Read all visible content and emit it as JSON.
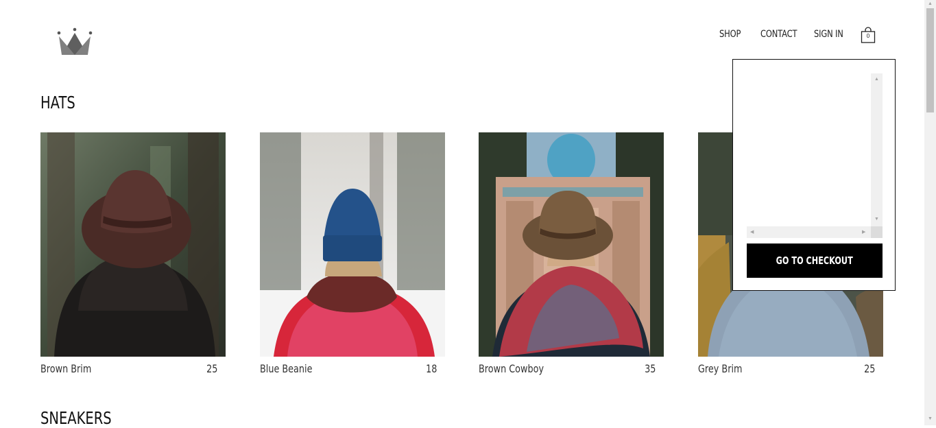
{
  "header": {
    "logo_icon": "crown-icon",
    "nav": [
      {
        "label": "SHOP"
      },
      {
        "label": "CONTACT"
      },
      {
        "label": "SIGN IN"
      }
    ],
    "cart_icon": "shopping-bag-icon",
    "cart_count": "0"
  },
  "sections": [
    {
      "title": "HATS",
      "items": [
        {
          "name": "Brown Brim",
          "price": "25"
        },
        {
          "name": "Blue Beanie",
          "price": "18"
        },
        {
          "name": "Brown Cowboy",
          "price": "35"
        },
        {
          "name": "Grey Brim",
          "price": "25"
        }
      ]
    },
    {
      "title": "SNEAKERS"
    }
  ],
  "cart_dropdown": {
    "checkout_label": "GO TO CHECKOUT"
  },
  "colors": {
    "accent": "#000000",
    "background": "#ffffff"
  }
}
